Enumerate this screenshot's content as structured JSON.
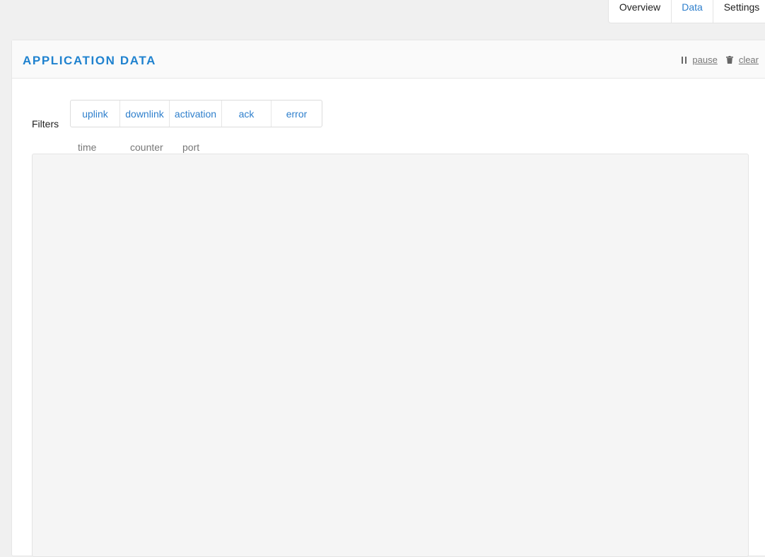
{
  "nav": {
    "tabs": [
      {
        "label": "Overview",
        "active": false
      },
      {
        "label": "Data",
        "active": true
      },
      {
        "label": "Settings",
        "active": false
      }
    ]
  },
  "panel": {
    "title": "APPLICATION DATA",
    "actions": {
      "pause": {
        "label": "pause",
        "icon": "pause-icon"
      },
      "clear": {
        "label": "clear",
        "icon": "trash-icon"
      }
    }
  },
  "filters": {
    "label": "Filters",
    "options": [
      "uplink",
      "downlink",
      "activation",
      "ack",
      "error"
    ]
  },
  "table": {
    "columns": [
      "time",
      "counter",
      "port"
    ],
    "rows": []
  },
  "colors": {
    "accent": "#1f82cf",
    "link": "#2e7fcc",
    "data_area_bg": "#f5f5f5"
  }
}
